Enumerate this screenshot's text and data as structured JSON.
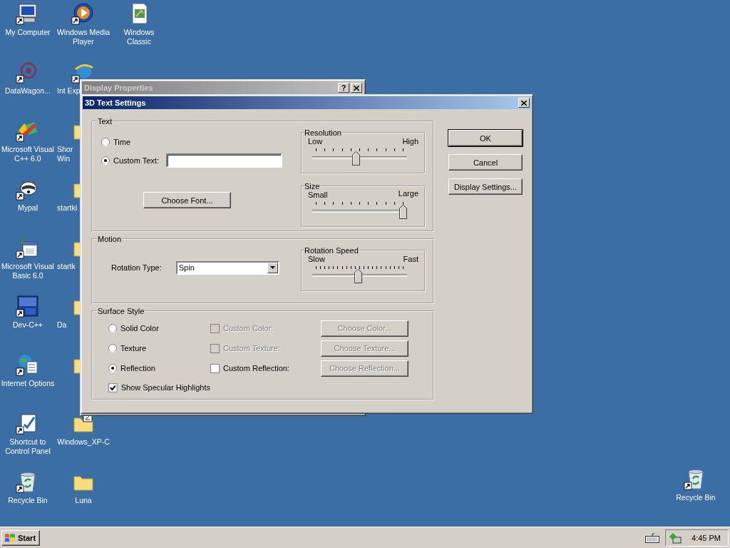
{
  "desktop": {
    "columns": [
      [
        {
          "kind": "computer",
          "label": "My Computer"
        },
        {
          "kind": "ghost",
          "label": "DataWagon..."
        },
        {
          "kind": "colorful",
          "label": "Microsoft Visual C++ 6.0"
        },
        {
          "kind": "raccoon",
          "label": "Mypal"
        },
        {
          "kind": "vb",
          "label": "Microsoft Visual Basic 6.0"
        },
        {
          "kind": "dev",
          "label": "Dev-C++"
        },
        {
          "kind": "options",
          "label": "Internet Options"
        },
        {
          "kind": "control",
          "label": "Shortcut to Control Panel"
        },
        {
          "kind": "recycle",
          "label": "Recycle Bin"
        }
      ],
      [
        {
          "kind": "media",
          "label": "Windows Media Player"
        },
        {
          "kind": "globe",
          "label": "Int Exp",
          "clipped": true
        },
        {
          "kind": "folder",
          "label": "Shor Win",
          "clipped": true
        },
        {
          "kind": "folder",
          "label": "startki",
          "clipped": true
        },
        {
          "kind": "folder",
          "label": "startk",
          "clipped": true
        },
        {
          "kind": "folder",
          "label": "Da",
          "clipped": true
        },
        {
          "kind": "folder"
        },
        {
          "kind": "zipfolder",
          "label": "Windows_XP-C"
        },
        {
          "kind": "folder",
          "label": "Luna"
        }
      ],
      [
        {
          "kind": "document",
          "label": "Windows Classic"
        }
      ]
    ],
    "corner_icon": {
      "kind": "recycle",
      "label": "Recycle Bin"
    }
  },
  "back_window": {
    "title": "Display Properties",
    "help": "?"
  },
  "dialog": {
    "title": "3D Text Settings",
    "text_group": {
      "label": "Text",
      "options": [
        {
          "label": "Time",
          "selected": false
        },
        {
          "label": "Custom Text:",
          "selected": true
        }
      ],
      "font_button": "Choose Font...",
      "sliders": [
        {
          "label": "Resolution",
          "low": "Low",
          "high": "High",
          "level": 0.46
        },
        {
          "label": "Size",
          "low": "Small",
          "high": "Large",
          "level": 1
        }
      ]
    },
    "motion_group": {
      "label": "Motion",
      "rotation_label": "Rotation Type:",
      "rotation_value": "Spin",
      "slider": {
        "label": "Rotation Speed",
        "low": "Slow",
        "high": "Fast",
        "level": 0.48
      }
    },
    "surface_group": {
      "label": "Surface Style",
      "rows": [
        {
          "option": {
            "label": "Solid Color",
            "selected": false
          },
          "custom": {
            "label": "Custom Color:",
            "checked": false,
            "disabled": true
          },
          "button": {
            "label": "Choose Color...",
            "disabled": true
          }
        },
        {
          "option": {
            "label": "Texture",
            "selected": false
          },
          "custom": {
            "label": "Custom Texture:",
            "checked": false,
            "disabled": true
          },
          "button": {
            "label": "Choose Texture...",
            "disabled": true
          }
        },
        {
          "option": {
            "label": "Reflection",
            "selected": true
          },
          "custom": {
            "label": "Custom Reflection:",
            "checked": false,
            "disabled": false
          },
          "button": {
            "label": "Choose Reflection...",
            "disabled": true
          }
        }
      ],
      "specular": {
        "label": "Show Specular Highlights",
        "checked": true
      }
    },
    "buttons": [
      {
        "label": "OK",
        "default": true
      },
      {
        "label": "Cancel",
        "default": false
      },
      {
        "label": "Display Settings...",
        "default": false
      }
    ]
  },
  "taskbar": {
    "start": "Start",
    "clock": "4:45 PM"
  }
}
